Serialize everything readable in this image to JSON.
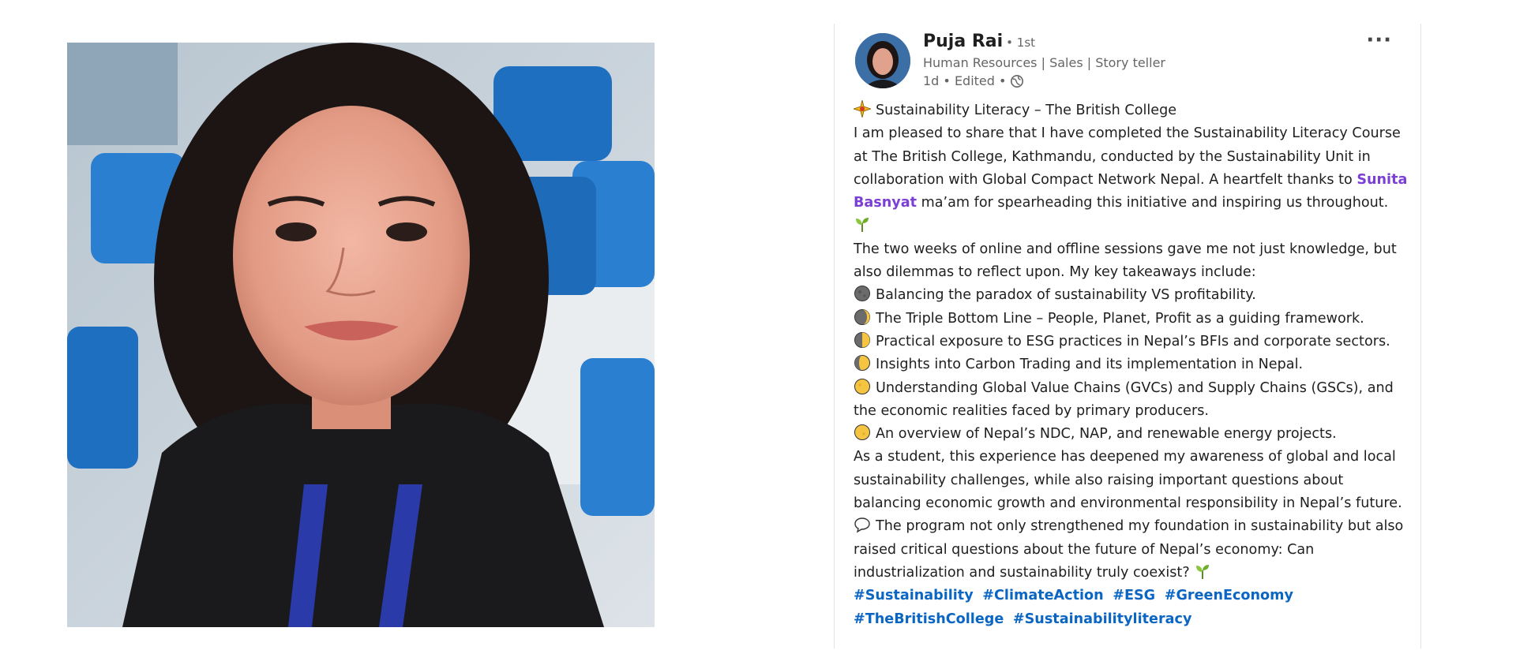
{
  "photo": {
    "description_icon": "selfie-photo"
  },
  "author": {
    "name": "Puja Rai",
    "degree": "• 1st",
    "headline": "Human Resources | Sales | Story teller",
    "time": "1d • Edited •"
  },
  "icons": {
    "more": "more-options-icon",
    "globe": "globe-icon",
    "sparkle": "sparkle-emoji",
    "seedling": "seedling-emoji",
    "moon": "moon-phase-emoji",
    "speech": "speech-bubble-emoji"
  },
  "post": {
    "title": "Sustainability Literacy – The British College",
    "intro_1": "I am pleased to share that I have completed the Sustainability Literacy Course at The British College, Kathmandu, conducted by the Sustainability Unit in collaboration with Global Compact Network Nepal. A heartfelt thanks to",
    "mention": "Sunita Basnyat",
    "intro_2": "ma’am for spearheading this initiative and inspiring us throughout.",
    "para_2": "The two weeks of online and offline sessions gave me not just knowledge, but also dilemmas to reflect upon. My key takeaways include:",
    "takeaways": [
      "Balancing the paradox of sustainability VS profitability.",
      "The Triple Bottom Line – People, Planet, Profit as a guiding framework.",
      "Practical exposure to ESG practices in Nepal’s BFIs and corporate sectors.",
      "Insights into Carbon Trading and its implementation in Nepal.",
      "Understanding Global Value Chains (GVCs) and Supply Chains (GSCs), and the economic realities faced by primary producers.",
      "An overview of Nepal’s NDC, NAP, and renewable energy projects."
    ],
    "para_3": "As a student, this experience has deepened my awareness of global and local sustainability challenges, while also raising important questions about balancing economic growth and environmental responsibility in Nepal’s future.",
    "para_4": "The program not only strengthened my foundation in sustainability but also raised critical questions about the future of Nepal’s economy: Can industrialization and sustainability truly coexist?",
    "hashtags": [
      "#Sustainability",
      "#ClimateAction",
      "#ESG",
      "#GreenEconomy",
      "#TheBritishCollege",
      "#Sustainabilityliteracy"
    ]
  },
  "colors": {
    "mention": "#7b3fd6",
    "hashtag": "#0a66c2",
    "meta": "#666666"
  }
}
